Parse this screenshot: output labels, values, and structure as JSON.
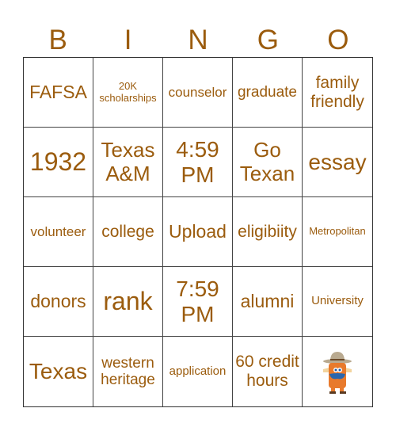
{
  "header": [
    "B",
    "I",
    "N",
    "G",
    "O"
  ],
  "cells": [
    "FAFSA",
    "20K scholarships",
    "counselor",
    "graduate",
    "family friendly",
    "1932",
    "Texas A&M",
    "4:59 PM",
    "Go Texan",
    "essay",
    "volunteer",
    "college",
    "Upload",
    "eligibiity",
    "Metropolitan",
    "donors",
    "rank",
    "7:59 PM",
    "alumni",
    "University",
    "Texas",
    "western heritage",
    "application",
    "60 credit hours",
    "free-space-mascot"
  ],
  "colors": {
    "text": "#9b5c0e",
    "grid": "#444444"
  }
}
